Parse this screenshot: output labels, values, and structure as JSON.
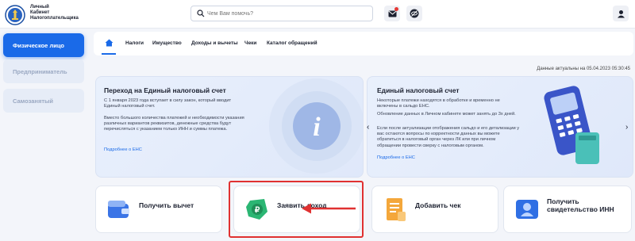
{
  "header": {
    "brand_lines": [
      "Личный",
      "Кабинет",
      "Налогоплательщика"
    ],
    "search_placeholder": "Чем Вам помочь?"
  },
  "sidebar": {
    "items": [
      {
        "label": "Физическое лицо",
        "active": true
      },
      {
        "label": "Предприниматель",
        "active": false
      },
      {
        "label": "Самозанятый",
        "active": false
      }
    ]
  },
  "nav": {
    "tabs": [
      "Налоги",
      "Имущество",
      "Доходы и вычеты",
      "Чеки",
      "Каталог обращений"
    ]
  },
  "as_of": "Данные актуальны на 05.04.2023 05:30:45",
  "card_left": {
    "title": "Переход на Единый налоговый счет",
    "p1": "С 1 января 2023 года вступает в силу закон, который вводит Единый налоговый счет.",
    "p2": "Вместо большого количества платежей и необходимости указания различных вариантов реквизитов, денежные средства будут перечисляться с указанием только ИНН и суммы платежа.",
    "link": "Подробнее о ЕНС"
  },
  "card_right": {
    "title": "Единый налоговый счет",
    "p1": "Некоторые платежи находятся в обработке и временно не включены в сальдо ЕНС.",
    "p2": "Обновление данных в Личном кабинете может занять до 3х дней.",
    "p3": "Если после актуализации отображения сальдо и его детализации у вас остаются вопросы по корректности данных вы можете обратиться в налоговый орган через ЛК или при личном обращении провести сверку с налоговым органом.",
    "link": "Подробнее о ЕНС"
  },
  "tiles": [
    {
      "label": "Получить вычет"
    },
    {
      "label": "Заявить доход"
    },
    {
      "label": "Добавить чек"
    },
    {
      "label": "Получить свидетельство ИНН"
    }
  ],
  "colors": {
    "accent": "#1a6ae8",
    "highlight": "#e03131"
  }
}
